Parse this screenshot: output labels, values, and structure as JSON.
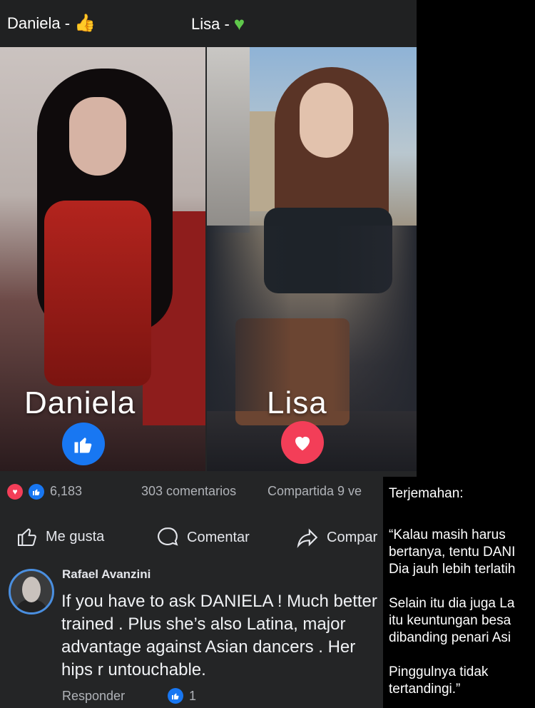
{
  "header": {
    "left_label": "Daniela -",
    "left_icon": "thumbs-up-emoji",
    "right_label": "Lisa -",
    "right_icon": "green-heart-emoji"
  },
  "photos": {
    "left_name": "Daniela",
    "left_reaction": "like-icon",
    "right_name": "Lisa",
    "right_reaction": "love-icon"
  },
  "stats": {
    "reactions_count": "6,183",
    "comments": "303 comentarios",
    "shares": "Compartida 9 ve"
  },
  "actions": {
    "like": "Me gusta",
    "comment": "Comentar",
    "share": "Compar"
  },
  "comment": {
    "author": "Rafael Avanzini",
    "text": "If you have to ask DANIELA ! Much better trained . Plus she’s also Latina, major advantage against Asian dancers . Her hips r untouchable.",
    "reply": "Responder",
    "like_count": "1"
  },
  "translation": {
    "title": "Terjemahan:",
    "p1_l1": "“Kalau masih harus",
    "p1_l2": "bertanya, tentu DANI",
    "p1_l3": "Dia jauh lebih terlatih",
    "p2_l1": "Selain itu dia juga La",
    "p2_l2": "itu keuntungan besa",
    "p2_l3": "dibanding penari Asi",
    "p3_l1": "Pinggulnya tidak",
    "p3_l2": "tertandingi.”"
  },
  "colors": {
    "like_blue": "#1877f2",
    "love_red": "#f33e58",
    "post_bg": "#242526"
  }
}
